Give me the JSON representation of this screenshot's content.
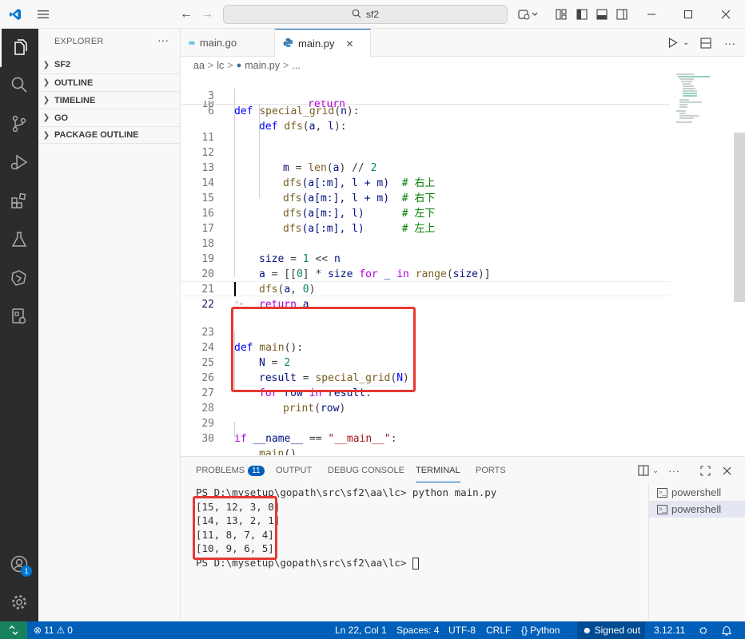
{
  "titlebar": {
    "search_text": "sf2"
  },
  "sidebar": {
    "title": "EXPLORER",
    "more": "···",
    "sections": [
      {
        "label": "SF2"
      },
      {
        "label": "OUTLINE"
      },
      {
        "label": "TIMELINE"
      },
      {
        "label": "GO"
      },
      {
        "label": "PACKAGE OUTLINE"
      }
    ]
  },
  "tabs": [
    {
      "label": "main.go",
      "icon": "go-file-icon"
    },
    {
      "label": "main.py",
      "icon": "python-file-icon",
      "close": "✕"
    }
  ],
  "breadcrumb": {
    "parts": [
      "aa",
      "lc",
      "main.py",
      "..."
    ],
    "sep": ">"
  },
  "editor": {
    "lines": [
      {
        "num": "3"
      },
      {
        "num": "6"
      },
      {
        "num": "10"
      },
      {
        "num": "11"
      },
      {
        "num": "12"
      },
      {
        "num": "13"
      },
      {
        "num": "14"
      },
      {
        "num": "15"
      },
      {
        "num": "16"
      },
      {
        "num": "17"
      },
      {
        "num": "18"
      },
      {
        "num": "19"
      },
      {
        "num": "20"
      },
      {
        "num": "21"
      },
      {
        "num": "22"
      },
      {
        "num": "23"
      },
      {
        "num": "24"
      },
      {
        "num": "25"
      },
      {
        "num": "26"
      },
      {
        "num": "27"
      },
      {
        "num": "28"
      },
      {
        "num": "29"
      },
      {
        "num": "30"
      }
    ],
    "code": {
      "l3": [
        "def",
        "special_grid",
        "(",
        "n",
        "):"
      ],
      "l6": [
        "def",
        "dfs",
        "(",
        "a",
        ", ",
        "l",
        "):"
      ],
      "l10": "return",
      "l12": [
        "m",
        " = ",
        "len",
        "(",
        "a",
        ") // ",
        "2"
      ],
      "l13": [
        "dfs",
        "(a[:m], l + m)  ",
        "# 右上"
      ],
      "l14": [
        "dfs",
        "(a[m:], l + m)  ",
        "# 右下"
      ],
      "l15": [
        "dfs",
        "(a[m:], l)      ",
        "# 左下"
      ],
      "l16": [
        "dfs",
        "(a[:m], l)      ",
        "# 左上"
      ],
      "l18": [
        "size",
        " = ",
        "1",
        " << ",
        "n"
      ],
      "l19": [
        "a",
        " = [[",
        "0",
        "] * ",
        "size",
        " ",
        "for",
        " _ ",
        "in",
        " ",
        "range",
        "(",
        "size",
        ")]"
      ],
      "l20": [
        "dfs",
        "(",
        "a",
        ", ",
        "0",
        ")"
      ],
      "l21": [
        "return",
        " ",
        "a"
      ],
      "l23": [
        "def",
        " ",
        "main",
        "():"
      ],
      "l24": [
        "N",
        " = ",
        "2"
      ],
      "l25": [
        "result",
        " = ",
        "special_grid",
        "(",
        "N",
        ")"
      ],
      "l26": [
        "for",
        " ",
        "row",
        " ",
        "in",
        " ",
        "result",
        ":"
      ],
      "l27": [
        "print",
        "(",
        "row",
        ")"
      ],
      "l29": [
        "if",
        " ",
        "__name__",
        " == ",
        "\"__main__\"",
        ":"
      ],
      "l30": [
        "main",
        "()"
      ]
    }
  },
  "panel": {
    "tabs": [
      {
        "label": "PROBLEMS",
        "badge": "11"
      },
      {
        "label": "OUTPUT"
      },
      {
        "label": "DEBUG CONSOLE"
      },
      {
        "label": "TERMINAL"
      },
      {
        "label": "PORTS"
      }
    ],
    "terminal_lines": [
      "PS D:\\mysetup\\gopath\\src\\sf2\\aa\\lc> python main.py",
      "[15, 12, 3, 0]",
      "[14, 13, 2, 1]",
      "[11, 8, 7, 4]",
      "[10, 9, 6, 5]",
      "PS D:\\mysetup\\gopath\\src\\sf2\\aa\\lc> "
    ],
    "terminal_instances": [
      {
        "label": "powershell"
      },
      {
        "label": "powershell"
      }
    ]
  },
  "activity": {
    "accounts_badge": "1"
  },
  "statusbar": {
    "errors": "11",
    "warnings": "0",
    "position": "Ln 22, Col 1",
    "spaces": "Spaces: 4",
    "encoding": "UTF-8",
    "eol": "CRLF",
    "language": "Python",
    "signed": "Signed out",
    "version": "3.12.11"
  },
  "colors": {
    "accent": "#005fb8",
    "highlight_box": "#e53935",
    "activity_bar": "#2c2c2c",
    "remote": "#16825d"
  }
}
